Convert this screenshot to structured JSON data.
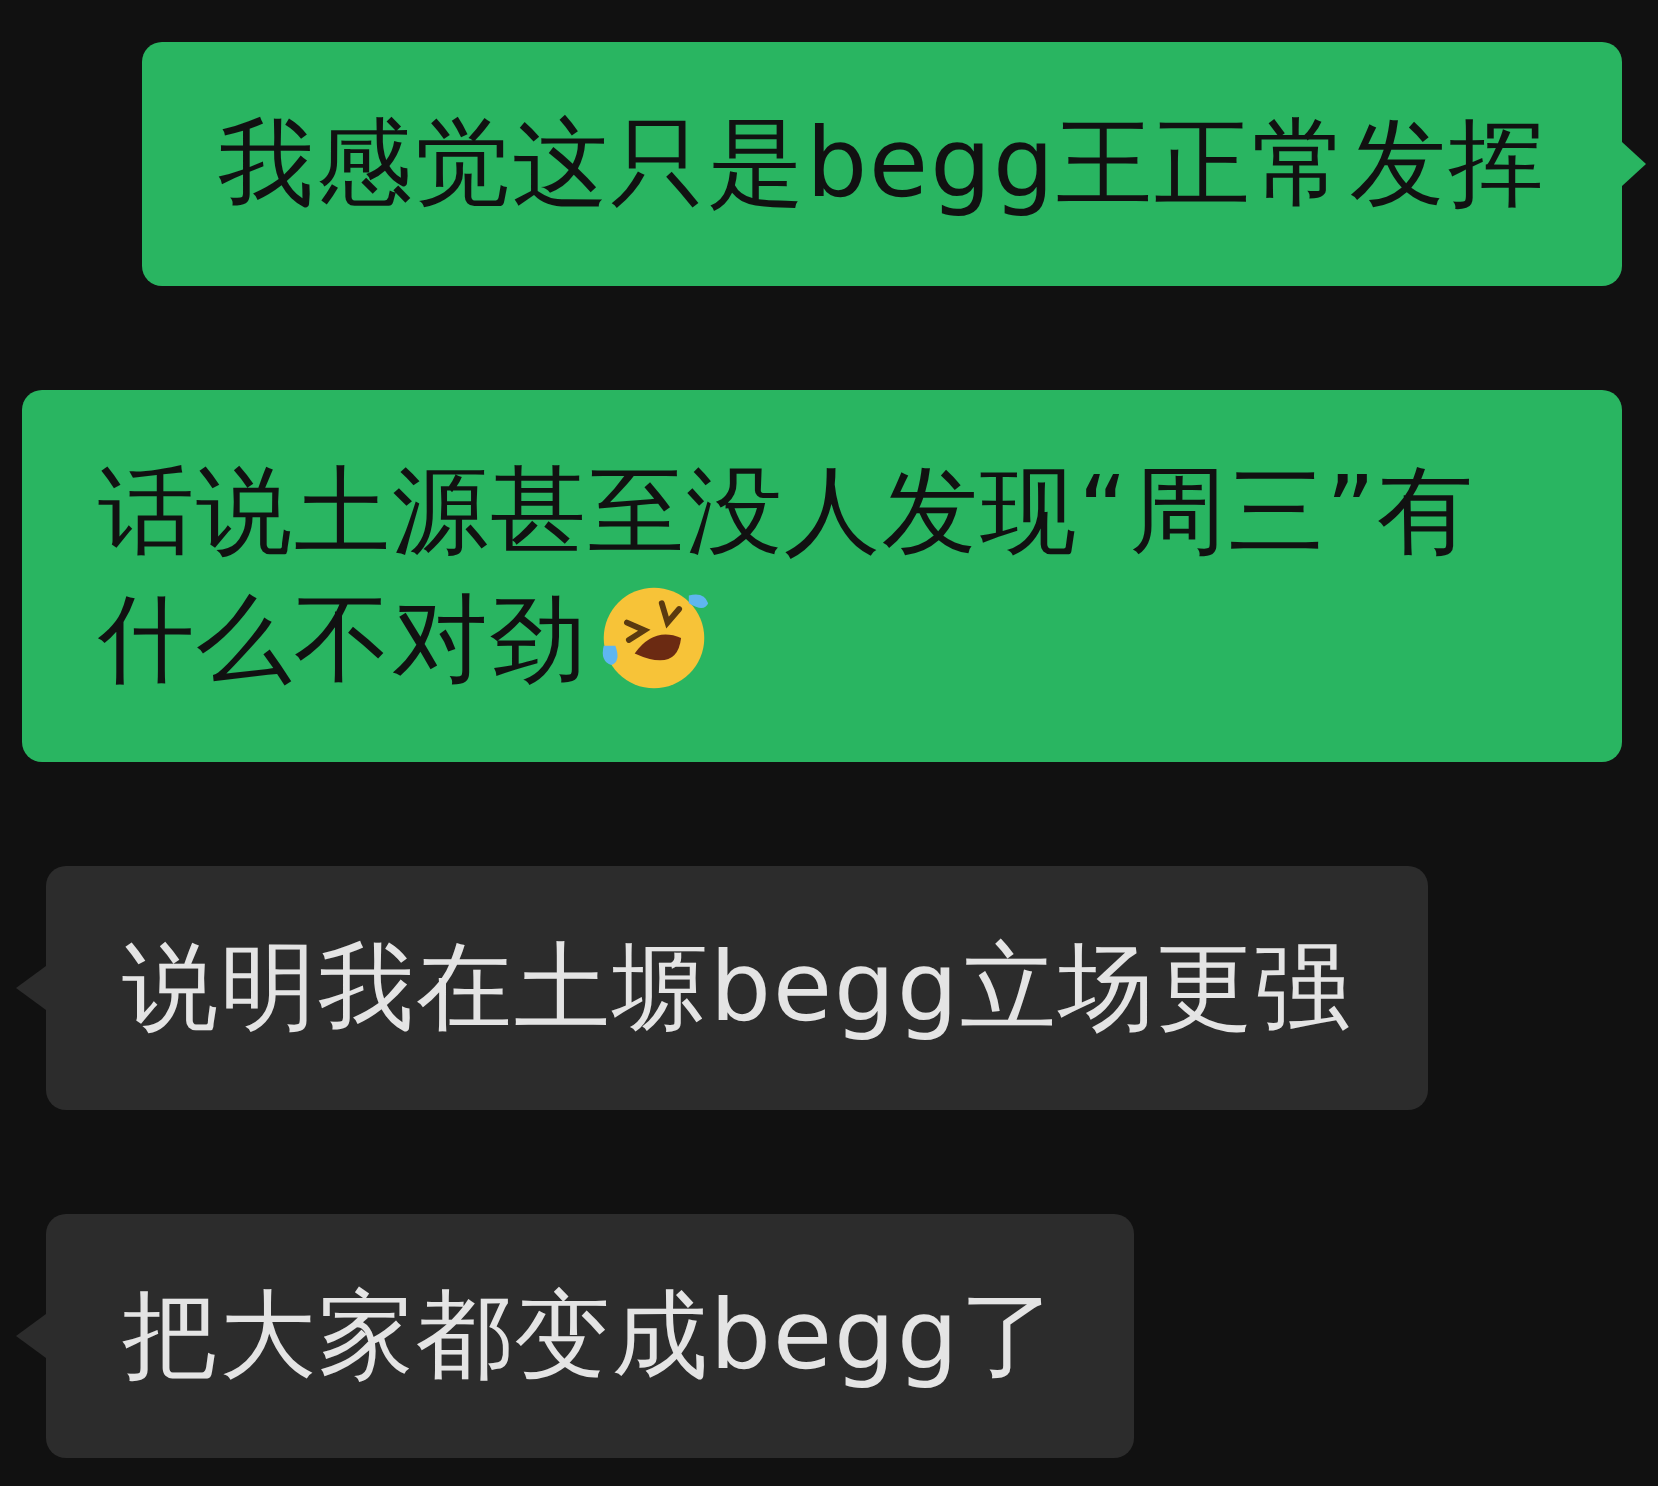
{
  "messages": [
    {
      "kind": "outgoing",
      "text": "我感觉这只是begg王正常发挥",
      "tail": true
    },
    {
      "kind": "outgoing",
      "text": "话说土源甚至没人发现“周三”有什么不对劲",
      "tail": false,
      "trailing_emoji": true
    },
    {
      "kind": "incoming",
      "text": "说明我在土塬begg立场更强",
      "tail": true
    },
    {
      "kind": "incoming",
      "text": "把大家都变成begg了",
      "tail": true
    }
  ]
}
